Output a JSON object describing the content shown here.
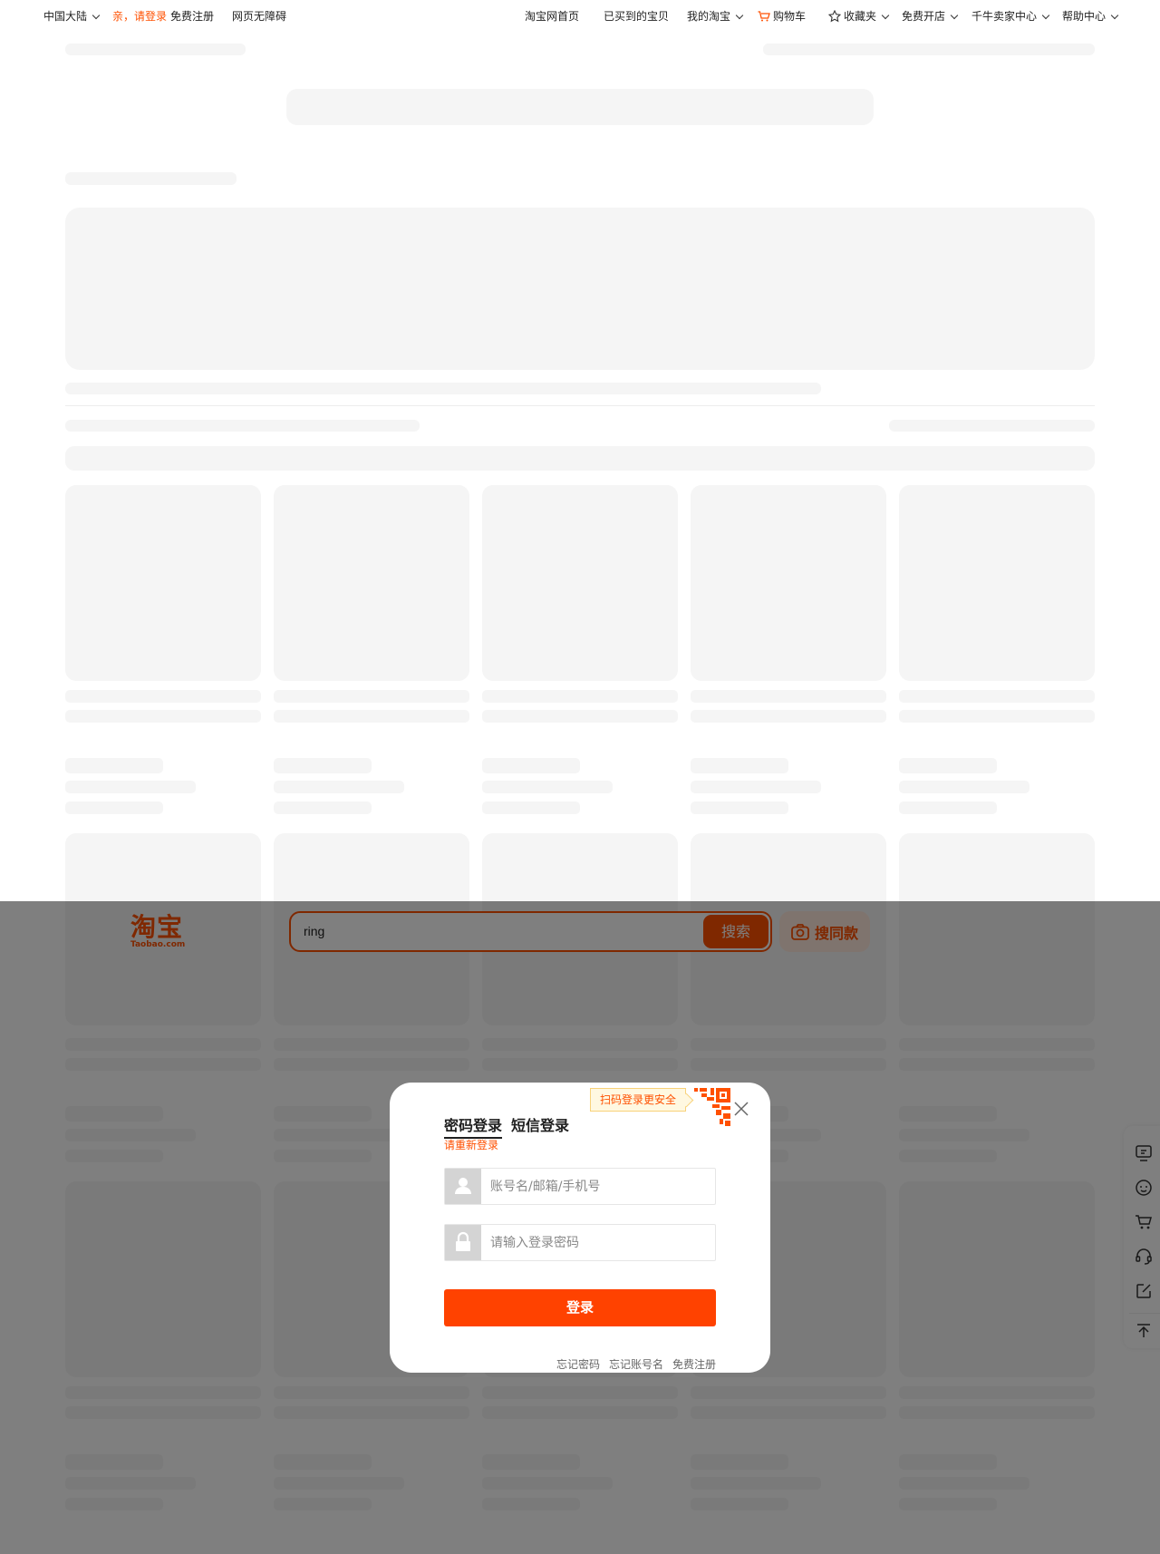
{
  "topbar": {
    "region": "中国大陆",
    "greeting": "亲，请登录",
    "register": "免费注册",
    "accessibility": "网页无障碍",
    "home": "淘宝网首页",
    "bought": "已买到的宝贝",
    "my_taobao": "我的淘宝",
    "cart": "购物车",
    "favorites": "收藏夹",
    "open_store": "免费开店",
    "seller_center": "千牛卖家中心",
    "help": "帮助中心"
  },
  "header": {
    "logo_cn": "淘宝",
    "logo_en": "Taobao.com",
    "search_value": "ring",
    "search_button": "搜索",
    "image_search_button": "搜同款"
  },
  "login_modal": {
    "qr_tip": "扫码登录更安全",
    "tab_password": "密码登录",
    "tab_sms": "短信登录",
    "relogin": "请重新登录",
    "username_placeholder": "账号名/邮箱/手机号",
    "password_placeholder": "请输入登录密码",
    "login_button": "登录",
    "forgot_password": "忘记密码",
    "forgot_account": "忘记账号名",
    "free_register": "免费注册"
  },
  "sidebar": {
    "icons": [
      "feedback-screen-icon",
      "smile-icon",
      "cart-icon",
      "customer-service-icon",
      "edit-icon",
      "back-to-top-icon"
    ]
  },
  "colors": {
    "brand": "#ff5000",
    "login_button": "#ff4200",
    "skeleton": "#f5f5f5"
  }
}
